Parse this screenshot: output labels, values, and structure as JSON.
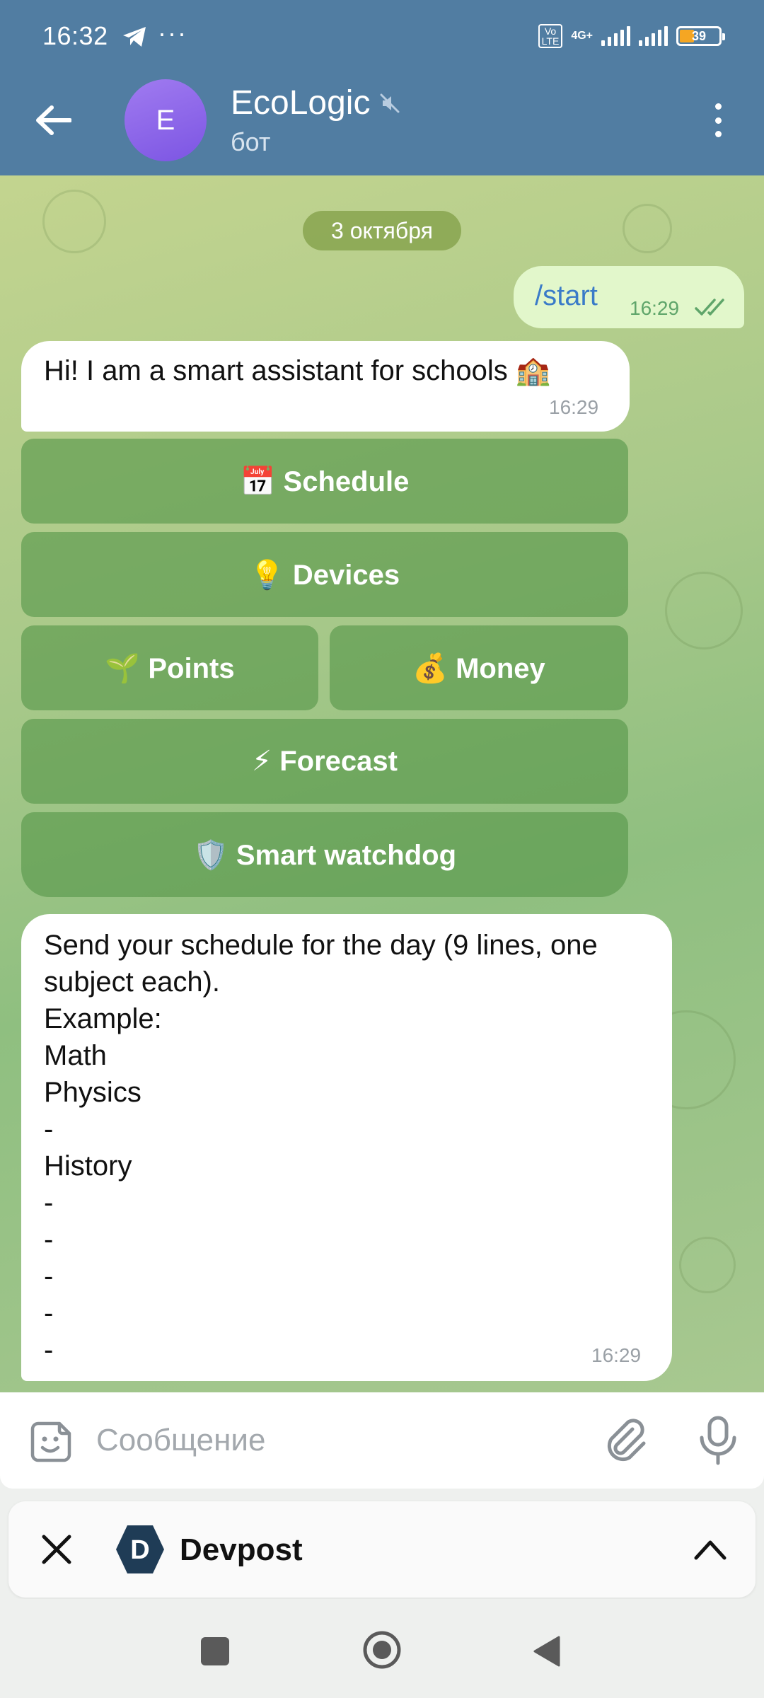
{
  "status_bar": {
    "time": "16:32",
    "overflow": "···",
    "volte": "Vo\nLTE",
    "network": "4G+",
    "battery": "39",
    "icons": [
      "telegram-icon",
      "signal-icon",
      "battery-icon"
    ]
  },
  "header": {
    "avatar_letter": "E",
    "title": "EcoLogic",
    "subtitle": "бот",
    "avatar_color": "#8d66ea",
    "bar_color": "#517da2"
  },
  "chat": {
    "date": "3 октября",
    "outgoing": {
      "text": "/start",
      "time": "16:29"
    },
    "greeting": {
      "text": "Hi! I am a smart assistant for schools 🏫",
      "time": "16:29"
    },
    "keyboard": {
      "schedule": "📅 Schedule",
      "devices": "💡 Devices",
      "points": "🌱 Points",
      "money": "💰 Money",
      "forecast": "⚡ Forecast",
      "watchdog": "🛡️ Smart watchdog"
    },
    "schedule_msg": {
      "text": "Send your schedule for the day (9 lines, one\nsubject each).\nExample:\nMath\nPhysics\n-\nHistory\n-\n-\n-\n-\n-",
      "time": "16:29"
    }
  },
  "input": {
    "placeholder": "Сообщение"
  },
  "panel": {
    "title": "Devpost",
    "logo_letter": "D"
  }
}
